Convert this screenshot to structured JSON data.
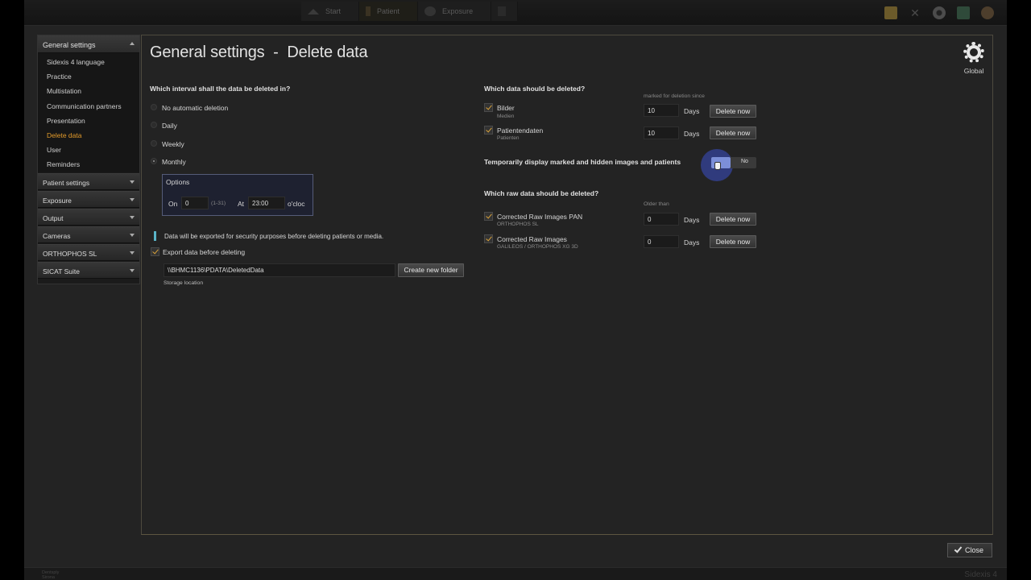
{
  "topbar": {
    "nav": [
      {
        "label": "Start",
        "icon": "home-icon"
      },
      {
        "label": "Patient",
        "icon": "patient-icon"
      },
      {
        "label": "Exposure",
        "icon": "exposure-icon"
      }
    ]
  },
  "sidebar": {
    "header": "General settings",
    "items": [
      {
        "label": "Sidexis 4 language"
      },
      {
        "label": "Practice"
      },
      {
        "label": "Multistation"
      },
      {
        "label": "Communication partners"
      },
      {
        "label": "Presentation"
      },
      {
        "label": "Delete data",
        "active": true
      },
      {
        "label": "User"
      },
      {
        "label": "Reminders"
      }
    ],
    "groups": [
      "Patient settings",
      "Exposure",
      "Output",
      "Cameras",
      "ORTHOPHOS SL",
      "SICAT Suite"
    ]
  },
  "page": {
    "title": "General settings  -  Delete data",
    "global_label": "Global"
  },
  "interval": {
    "heading": "Which interval shall the data be deleted in?",
    "options": [
      "No automatic deletion",
      "Daily",
      "Weekly",
      "Monthly"
    ],
    "selected": "Monthly",
    "options_box": {
      "title": "Options",
      "on_label": "On",
      "on_value": "0",
      "range_hint": "(1-31)",
      "at_label": "At",
      "time_value": "23:00",
      "unit": "o'cloc"
    },
    "info_text": "Data will be exported for security purposes before deleting patients or media.",
    "export_label": "Export data before deleting",
    "path_value": "\\\\BHMC1136\\PDATA\\DeletedData",
    "create_folder": "Create new folder",
    "storage_label": "Storage location"
  },
  "delete_data": {
    "heading": "Which data should be deleted?",
    "since_label": "marked for deletion since",
    "rows": [
      {
        "label": "Bilder",
        "sub": "Medien",
        "value": "10",
        "unit": "Days",
        "button": "Delete now"
      },
      {
        "label": "Patientendaten",
        "sub": "Patienten",
        "value": "10",
        "unit": "Days",
        "button": "Delete now"
      }
    ],
    "temp_display_label": "Temporarily display marked and hidden images and patients",
    "toggle_text": "No"
  },
  "raw_data": {
    "heading": "Which raw data should be deleted?",
    "older_label": "Older than",
    "rows": [
      {
        "label": "Corrected Raw Images PAN",
        "sub": "ORTHOPHOS SL",
        "value": "0",
        "unit": "Days",
        "button": "Delete now"
      },
      {
        "label": "Corrected Raw Images",
        "sub": "GALILEOS / ORTHOPHOS XG 3D",
        "value": "0",
        "unit": "Days",
        "button": "Delete now"
      }
    ]
  },
  "footer": {
    "close_label": "Close",
    "brand_line1": "Dentsply",
    "brand_line2": "Sirona",
    "version": "Sidexis 4"
  }
}
